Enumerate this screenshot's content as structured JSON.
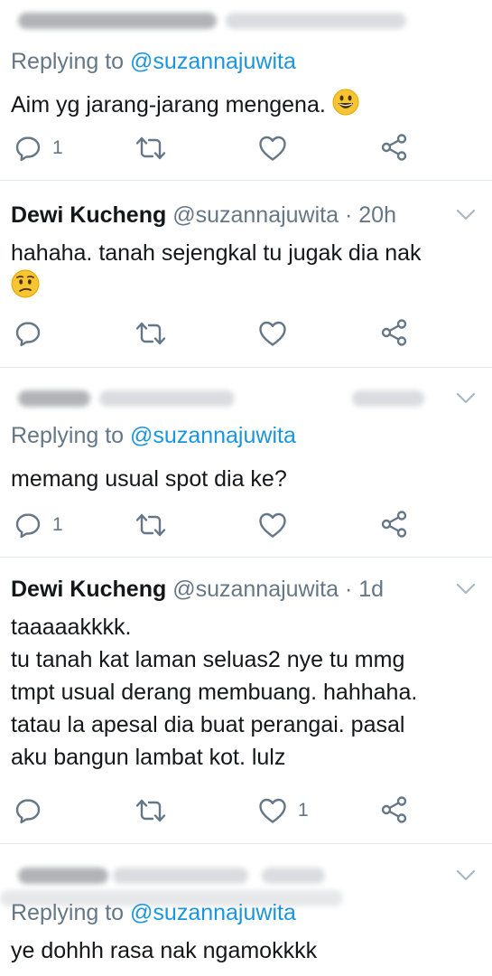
{
  "tweets": [
    {
      "replying_prefix": "Replying to",
      "replying_handle": "@suzannajuwita",
      "text": "Aim yg jarang-jarang mengena.",
      "reply_count": "1",
      "like_count": ""
    },
    {
      "name": "Dewi Kucheng",
      "handle": "@suzannajuwita",
      "time": "· 20h",
      "lines": [
        "hahaha. tanah sejengkal tu jugak dia nak"
      ],
      "reply_count": "",
      "like_count": ""
    },
    {
      "replying_prefix": "Replying to",
      "replying_handle": "@suzannajuwita",
      "text": "memang usual spot dia ke?",
      "reply_count": "1",
      "like_count": ""
    },
    {
      "name": "Dewi Kucheng",
      "handle": "@suzannajuwita",
      "time": "· 1d",
      "lines": [
        "taaaaakkkk.",
        "tu tanah kat laman seluas2 nye tu mmg",
        "tmpt usual derang membuang. hahhaha.",
        "tatau la apesal dia buat perangai. pasal",
        "aku bangun lambat kot. lulz"
      ],
      "reply_count": "",
      "like_count": "1"
    },
    {
      "replying_prefix": "Replying to",
      "replying_handle": "@suzannajuwita",
      "text": "ye dohhh rasa nak ngamokkkk"
    }
  ],
  "icons": {
    "reply": "reply-icon",
    "retweet": "retweet-icon",
    "like": "heart-icon",
    "share": "share-icon",
    "menu": "chevron-down-icon",
    "emoji_grin": "grinning-face-icon",
    "emoji_confused": "confused-face-icon"
  },
  "colors": {
    "secondary_text": "#657786",
    "link": "#1b95e0",
    "divider": "#e1e8ed"
  }
}
